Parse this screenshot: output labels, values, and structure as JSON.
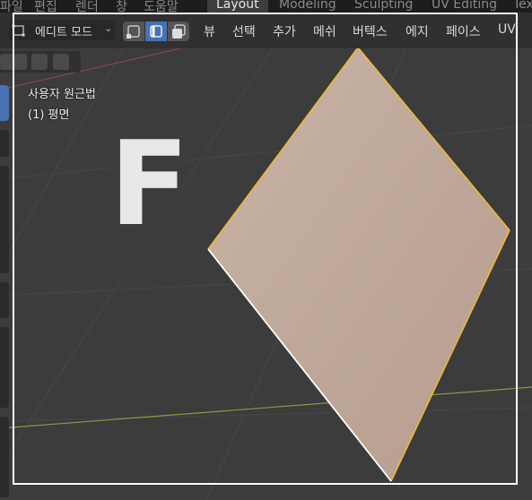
{
  "top_tabs": [
    "파일",
    "편집",
    "렌더",
    "창",
    "도움말",
    "Layout",
    "Modeling",
    "Sculpting",
    "UV Editing",
    "Tex"
  ],
  "active_tab": "Layout",
  "header": {
    "mode_icon": "edit-mode-icon",
    "mode_label": "에디트 모드",
    "mode_chevron": "chevron-down-icon",
    "select_modes": [
      "vertex-select-icon",
      "edge-select-icon",
      "face-select-icon"
    ],
    "active_select_mode": "edge-select-icon",
    "menus": [
      "뷰",
      "선택",
      "추가",
      "메쉬",
      "버텍스",
      "에지",
      "페이스",
      "UV"
    ]
  },
  "viewport": {
    "view_name": "사용자 원근법",
    "object_info": "(1) 평면",
    "key_overlay": "F"
  },
  "colors": {
    "accent_blue": "#4772b3",
    "face_fill": "#c2ab9c",
    "selected_edge": "#f5b82e",
    "x_axis": "#8a9a3e",
    "y_axis": "#8b4450",
    "frame": "#ffffff"
  }
}
